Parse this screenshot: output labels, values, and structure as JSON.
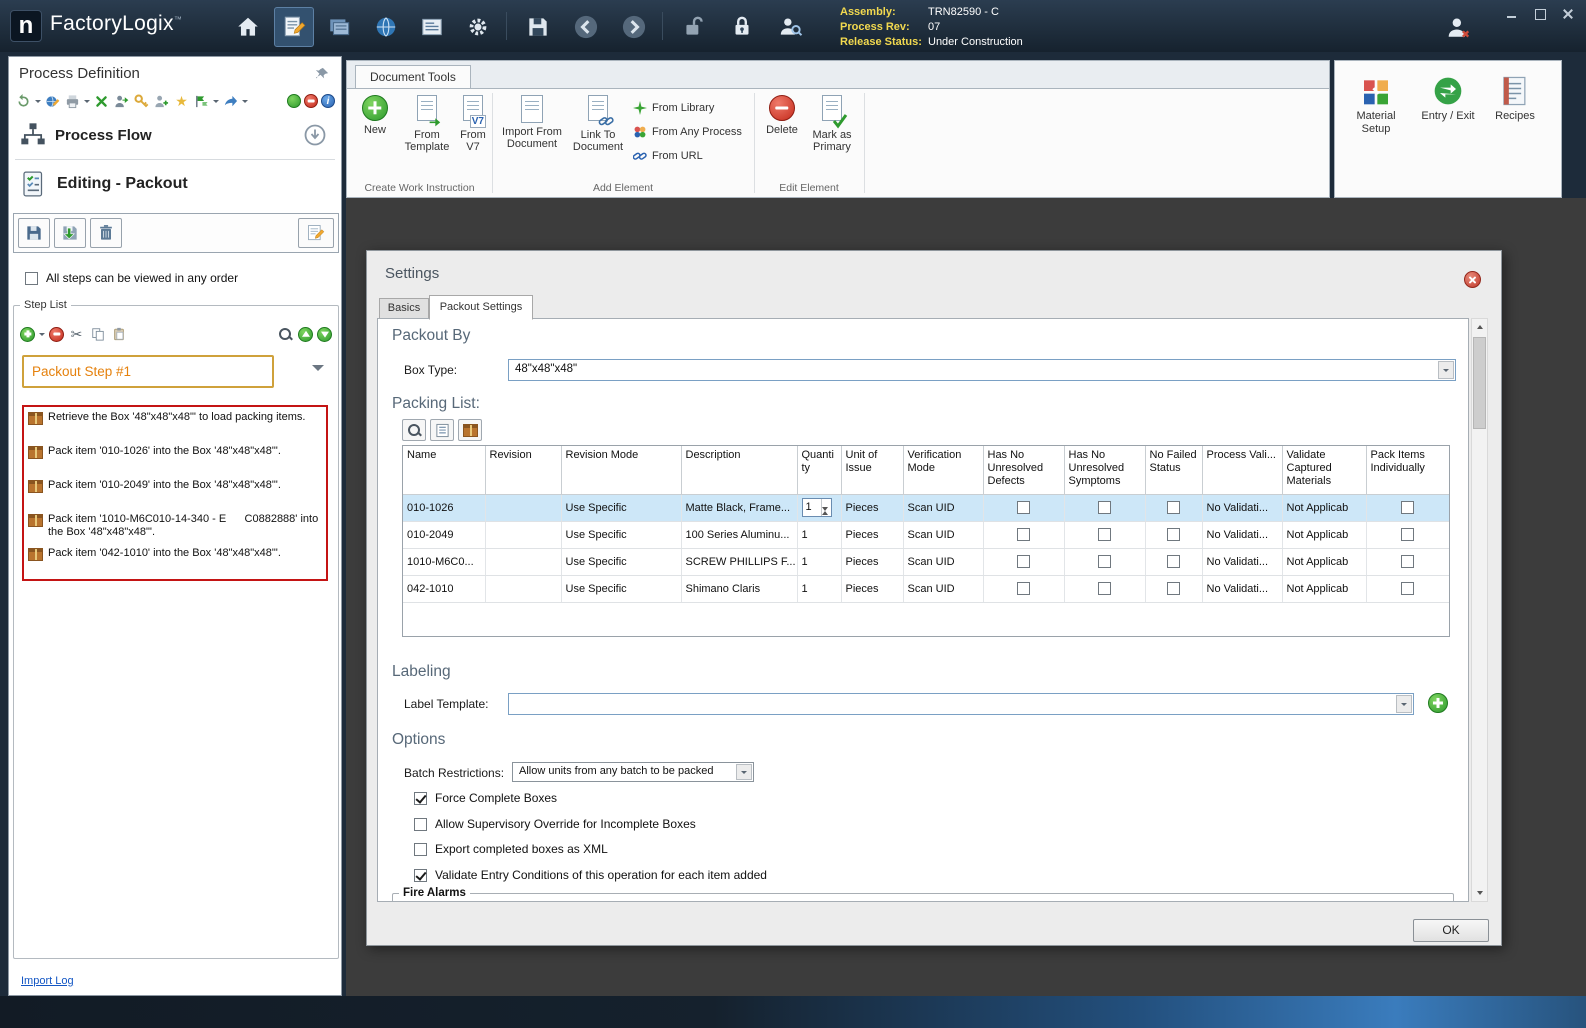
{
  "icons": {
    "scissors": "✂",
    "star": "★"
  },
  "titlebar": {
    "logo_letter": "n",
    "app_name": "FactoryLogix",
    "trademark": "™",
    "info": {
      "assembly_label": "Assembly:",
      "assembly_value": "TRN82590 - C",
      "process_rev_label": "Process Rev:",
      "process_rev_value": "07",
      "release_status_label": "Release Status:",
      "release_status_value": "Under Construction"
    }
  },
  "left_panel": {
    "title": "Process Definition",
    "process_flow_label": "Process Flow",
    "editing_label": "Editing - Packout",
    "order_checkbox": {
      "label": "All steps can be viewed in any order",
      "checked": false
    },
    "step_list": {
      "title": "Step List",
      "selected_step": "Packout Step #1",
      "steps": [
        {
          "text": "Retrieve the Box '48\"x48\"x48\"' to load packing items."
        },
        {
          "text": "Pack item '010-1026' into the Box '48\"x48\"x48\"'."
        },
        {
          "text": "Pack item '010-2049' into the Box '48\"x48\"x48\"'."
        },
        {
          "text": "Pack item '1010-M6C010-14-340 - E      C0882888' into the Box '48\"x48\"x48\"'."
        },
        {
          "text": "Pack item '042-1010' into the Box '48\"x48\"x48\"'."
        }
      ]
    },
    "import_log_link": "Import Log"
  },
  "ribbon": {
    "tab_label": "Document Tools",
    "create_group": {
      "label": "Create Work Instruction",
      "new": "New",
      "from_template": "From Template",
      "from_v7": "From V7"
    },
    "add_group": {
      "label": "Add Element",
      "import_from_document": "Import From Document",
      "link_to_document": "Link To Document",
      "from_library": "From Library",
      "from_any_process": "From Any Process",
      "from_url": "From URL"
    },
    "edit_group": {
      "label": "Edit Element",
      "delete": "Delete",
      "mark_as_primary": "Mark as Primary"
    },
    "right_buttons": {
      "material_setup": "Material Setup",
      "entry_exit": "Entry / Exit",
      "recipes": "Recipes"
    }
  },
  "settings": {
    "title": "Settings",
    "tabs": {
      "basics": "Basics",
      "packout": "Packout Settings"
    },
    "packout_by": {
      "heading": "Packout By",
      "box_type_label": "Box Type:",
      "box_type_value": "48\"x48\"x48\""
    },
    "packing_list": {
      "heading": "Packing List:",
      "columns": [
        "Name",
        "Revision",
        "Revision Mode",
        "Description",
        "Quantity",
        "Unit of Issue",
        "Verification Mode",
        "Has No Unresolved Defects",
        "Has No Unresolved Symptoms",
        "No Failed Status",
        "Process Vali...",
        "Validate Captured Materials",
        "Pack Items Individually"
      ],
      "rows": [
        {
          "name": "010-1026",
          "revision": "",
          "revision_mode": "Use Specific",
          "description": "Matte Black, Frame...",
          "quantity": "1",
          "unit_of_issue": "Pieces",
          "verification_mode": "Scan UID",
          "process_validation": "No Validati...",
          "validate_captured_materials": "Not Applicab"
        },
        {
          "name": "010-2049",
          "revision": "",
          "revision_mode": "Use Specific",
          "description": "100 Series Aluminu...",
          "quantity": "1",
          "unit_of_issue": "Pieces",
          "verification_mode": "Scan UID",
          "process_validation": "No Validati...",
          "validate_captured_materials": "Not Applicab"
        },
        {
          "name": "1010-M6C0...",
          "revision": "",
          "revision_mode": "Use Specific",
          "description": "SCREW PHILLIPS F...",
          "quantity": "1",
          "unit_of_issue": "Pieces",
          "verification_mode": "Scan UID",
          "process_validation": "No Validati...",
          "validate_captured_materials": "Not Applicab"
        },
        {
          "name": "042-1010",
          "revision": "",
          "revision_mode": "Use Specific",
          "description": "Shimano Claris",
          "quantity": "1",
          "unit_of_issue": "Pieces",
          "verification_mode": "Scan UID",
          "process_validation": "No Validati...",
          "validate_captured_materials": "Not Applicab"
        }
      ]
    },
    "labeling": {
      "heading": "Labeling",
      "label_template_label": "Label Template:"
    },
    "options": {
      "heading": "Options",
      "batch_restrictions_label": "Batch Restrictions:",
      "batch_restrictions_value": "Allow units from any batch to be packed",
      "checkboxes": [
        {
          "label": "Force Complete Boxes",
          "checked": true
        },
        {
          "label": "Allow Supervisory Override for Incomplete Boxes",
          "checked": false
        },
        {
          "label": "Export completed boxes as XML",
          "checked": false
        },
        {
          "label": "Validate Entry Conditions of this operation for each item added",
          "checked": true
        }
      ]
    },
    "fire_alarms_heading": "Fire Alarms",
    "ok_button": "OK"
  }
}
